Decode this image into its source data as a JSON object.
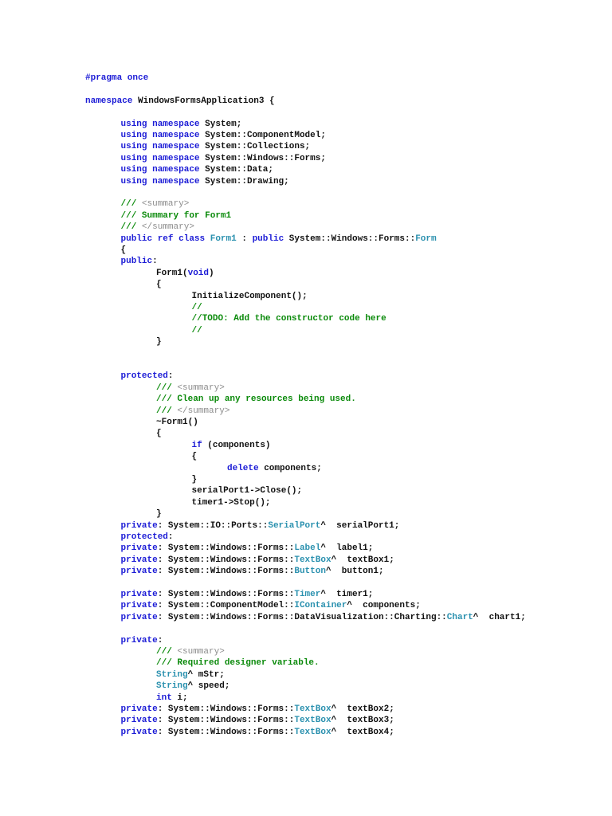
{
  "colors": {
    "keyword": "#1c1cd6",
    "type": "#2b91af",
    "comment": "#0a8a0a",
    "xml": "#8c8c8c",
    "plain": "#111111"
  },
  "lines": [
    {
      "i": 0,
      "t": [
        [
          "#pragma once",
          "k"
        ]
      ]
    },
    {
      "i": 0,
      "t": []
    },
    {
      "i": 0,
      "t": [
        [
          "namespace",
          "k"
        ],
        [
          " WindowsFormsApplication3 {",
          "p"
        ]
      ]
    },
    {
      "i": 0,
      "t": []
    },
    {
      "i": 1,
      "t": [
        [
          "using namespace",
          "k"
        ],
        [
          " System;",
          "p"
        ]
      ]
    },
    {
      "i": 1,
      "t": [
        [
          "using namespace",
          "k"
        ],
        [
          " System::ComponentModel;",
          "p"
        ]
      ]
    },
    {
      "i": 1,
      "t": [
        [
          "using namespace",
          "k"
        ],
        [
          " System::Collections;",
          "p"
        ]
      ]
    },
    {
      "i": 1,
      "t": [
        [
          "using namespace",
          "k"
        ],
        [
          " System::Windows::Forms;",
          "p"
        ]
      ]
    },
    {
      "i": 1,
      "t": [
        [
          "using namespace",
          "k"
        ],
        [
          " System::Data;",
          "p"
        ]
      ]
    },
    {
      "i": 1,
      "t": [
        [
          "using namespace",
          "k"
        ],
        [
          " System::Drawing;",
          "p"
        ]
      ]
    },
    {
      "i": 0,
      "t": []
    },
    {
      "i": 1,
      "t": [
        [
          "/// ",
          "c"
        ],
        [
          "<summary>",
          "g"
        ]
      ]
    },
    {
      "i": 1,
      "t": [
        [
          "/// Summary for Form1",
          "c"
        ]
      ]
    },
    {
      "i": 1,
      "t": [
        [
          "/// ",
          "c"
        ],
        [
          "</summary>",
          "g"
        ]
      ]
    },
    {
      "i": 1,
      "t": [
        [
          "public ref class",
          "k"
        ],
        [
          " ",
          "p"
        ],
        [
          "Form1",
          "t"
        ],
        [
          " : ",
          "p"
        ],
        [
          "public",
          "k"
        ],
        [
          " System::Windows::Forms::",
          "p"
        ],
        [
          "Form",
          "t"
        ]
      ]
    },
    {
      "i": 1,
      "t": [
        [
          "{",
          "p"
        ]
      ]
    },
    {
      "i": 1,
      "t": [
        [
          "public",
          "k"
        ],
        [
          ":",
          "p"
        ]
      ]
    },
    {
      "i": 2,
      "t": [
        [
          "Form1(",
          "p"
        ],
        [
          "void",
          "k"
        ],
        [
          ")",
          "p"
        ]
      ]
    },
    {
      "i": 2,
      "t": [
        [
          "{",
          "p"
        ]
      ]
    },
    {
      "i": 3,
      "t": [
        [
          "InitializeComponent();",
          "p"
        ]
      ]
    },
    {
      "i": 3,
      "t": [
        [
          "//",
          "c"
        ]
      ]
    },
    {
      "i": 3,
      "t": [
        [
          "//TODO: Add the constructor code here",
          "c"
        ]
      ]
    },
    {
      "i": 3,
      "t": [
        [
          "//",
          "c"
        ]
      ]
    },
    {
      "i": 2,
      "t": [
        [
          "}",
          "p"
        ]
      ]
    },
    {
      "i": 0,
      "t": []
    },
    {
      "i": 0,
      "t": []
    },
    {
      "i": 1,
      "t": [
        [
          "protected",
          "k"
        ],
        [
          ":",
          "p"
        ]
      ]
    },
    {
      "i": 2,
      "t": [
        [
          "/// ",
          "c"
        ],
        [
          "<summary>",
          "g"
        ]
      ]
    },
    {
      "i": 2,
      "t": [
        [
          "/// Clean up any resources being used.",
          "c"
        ]
      ]
    },
    {
      "i": 2,
      "t": [
        [
          "/// ",
          "c"
        ],
        [
          "</summary>",
          "g"
        ]
      ]
    },
    {
      "i": 2,
      "t": [
        [
          "~Form1()",
          "p"
        ]
      ]
    },
    {
      "i": 2,
      "t": [
        [
          "{",
          "p"
        ]
      ]
    },
    {
      "i": 3,
      "t": [
        [
          "if",
          "k"
        ],
        [
          " (components)",
          "p"
        ]
      ]
    },
    {
      "i": 3,
      "t": [
        [
          "{",
          "p"
        ]
      ]
    },
    {
      "i": 4,
      "t": [
        [
          "delete",
          "k"
        ],
        [
          " components;",
          "p"
        ]
      ]
    },
    {
      "i": 3,
      "t": [
        [
          "}",
          "p"
        ]
      ]
    },
    {
      "i": 3,
      "t": [
        [
          "serialPort1->Close();",
          "p"
        ]
      ]
    },
    {
      "i": 3,
      "t": [
        [
          "timer1->Stop();",
          "p"
        ]
      ]
    },
    {
      "i": 2,
      "t": [
        [
          "}",
          "p"
        ]
      ]
    },
    {
      "i": 1,
      "t": [
        [
          "private",
          "k"
        ],
        [
          ": System::IO::Ports::",
          "p"
        ],
        [
          "SerialPort",
          "t"
        ],
        [
          "^  serialPort1;",
          "p"
        ]
      ]
    },
    {
      "i": 1,
      "t": [
        [
          "protected",
          "k"
        ],
        [
          ":",
          "p"
        ]
      ]
    },
    {
      "i": 1,
      "t": [
        [
          "private",
          "k"
        ],
        [
          ": System::Windows::Forms::",
          "p"
        ],
        [
          "Label",
          "t"
        ],
        [
          "^  label1;",
          "p"
        ]
      ]
    },
    {
      "i": 1,
      "t": [
        [
          "private",
          "k"
        ],
        [
          ": System::Windows::Forms::",
          "p"
        ],
        [
          "TextBox",
          "t"
        ],
        [
          "^  textBox1;",
          "p"
        ]
      ]
    },
    {
      "i": 1,
      "t": [
        [
          "private",
          "k"
        ],
        [
          ": System::Windows::Forms::",
          "p"
        ],
        [
          "Button",
          "t"
        ],
        [
          "^  button1;",
          "p"
        ]
      ]
    },
    {
      "i": 0,
      "t": []
    },
    {
      "i": 1,
      "t": [
        [
          "private",
          "k"
        ],
        [
          ": System::Windows::Forms::",
          "p"
        ],
        [
          "Timer",
          "t"
        ],
        [
          "^  timer1;",
          "p"
        ]
      ]
    },
    {
      "i": 1,
      "t": [
        [
          "private",
          "k"
        ],
        [
          ": System::ComponentModel::",
          "p"
        ],
        [
          "IContainer",
          "t"
        ],
        [
          "^  components;",
          "p"
        ]
      ]
    },
    {
      "i": 1,
      "t": [
        [
          "private",
          "k"
        ],
        [
          ": System::Windows::Forms::DataVisualization::Charting::",
          "p"
        ],
        [
          "Chart",
          "t"
        ],
        [
          "^  chart1;",
          "p"
        ]
      ]
    },
    {
      "i": 0,
      "t": []
    },
    {
      "i": 1,
      "t": [
        [
          "private",
          "k"
        ],
        [
          ":",
          "p"
        ]
      ]
    },
    {
      "i": 2,
      "t": [
        [
          "/// ",
          "c"
        ],
        [
          "<summary>",
          "g"
        ]
      ]
    },
    {
      "i": 2,
      "t": [
        [
          "/// Required designer variable.",
          "c"
        ]
      ]
    },
    {
      "i": 2,
      "t": [
        [
          "String",
          "t"
        ],
        [
          "^ mStr;",
          "p"
        ]
      ]
    },
    {
      "i": 2,
      "t": [
        [
          "String",
          "t"
        ],
        [
          "^ speed;",
          "p"
        ]
      ]
    },
    {
      "i": 2,
      "t": [
        [
          "int",
          "k"
        ],
        [
          " i;",
          "p"
        ]
      ]
    },
    {
      "i": 1,
      "t": [
        [
          "private",
          "k"
        ],
        [
          ": System::Windows::Forms::",
          "p"
        ],
        [
          "TextBox",
          "t"
        ],
        [
          "^  textBox2;",
          "p"
        ]
      ]
    },
    {
      "i": 1,
      "t": [
        [
          "private",
          "k"
        ],
        [
          ": System::Windows::Forms::",
          "p"
        ],
        [
          "TextBox",
          "t"
        ],
        [
          "^  textBox3;",
          "p"
        ]
      ]
    },
    {
      "i": 1,
      "t": [
        [
          "private",
          "k"
        ],
        [
          ": System::Windows::Forms::",
          "p"
        ],
        [
          "TextBox",
          "t"
        ],
        [
          "^  textBox4;",
          "p"
        ]
      ]
    }
  ]
}
